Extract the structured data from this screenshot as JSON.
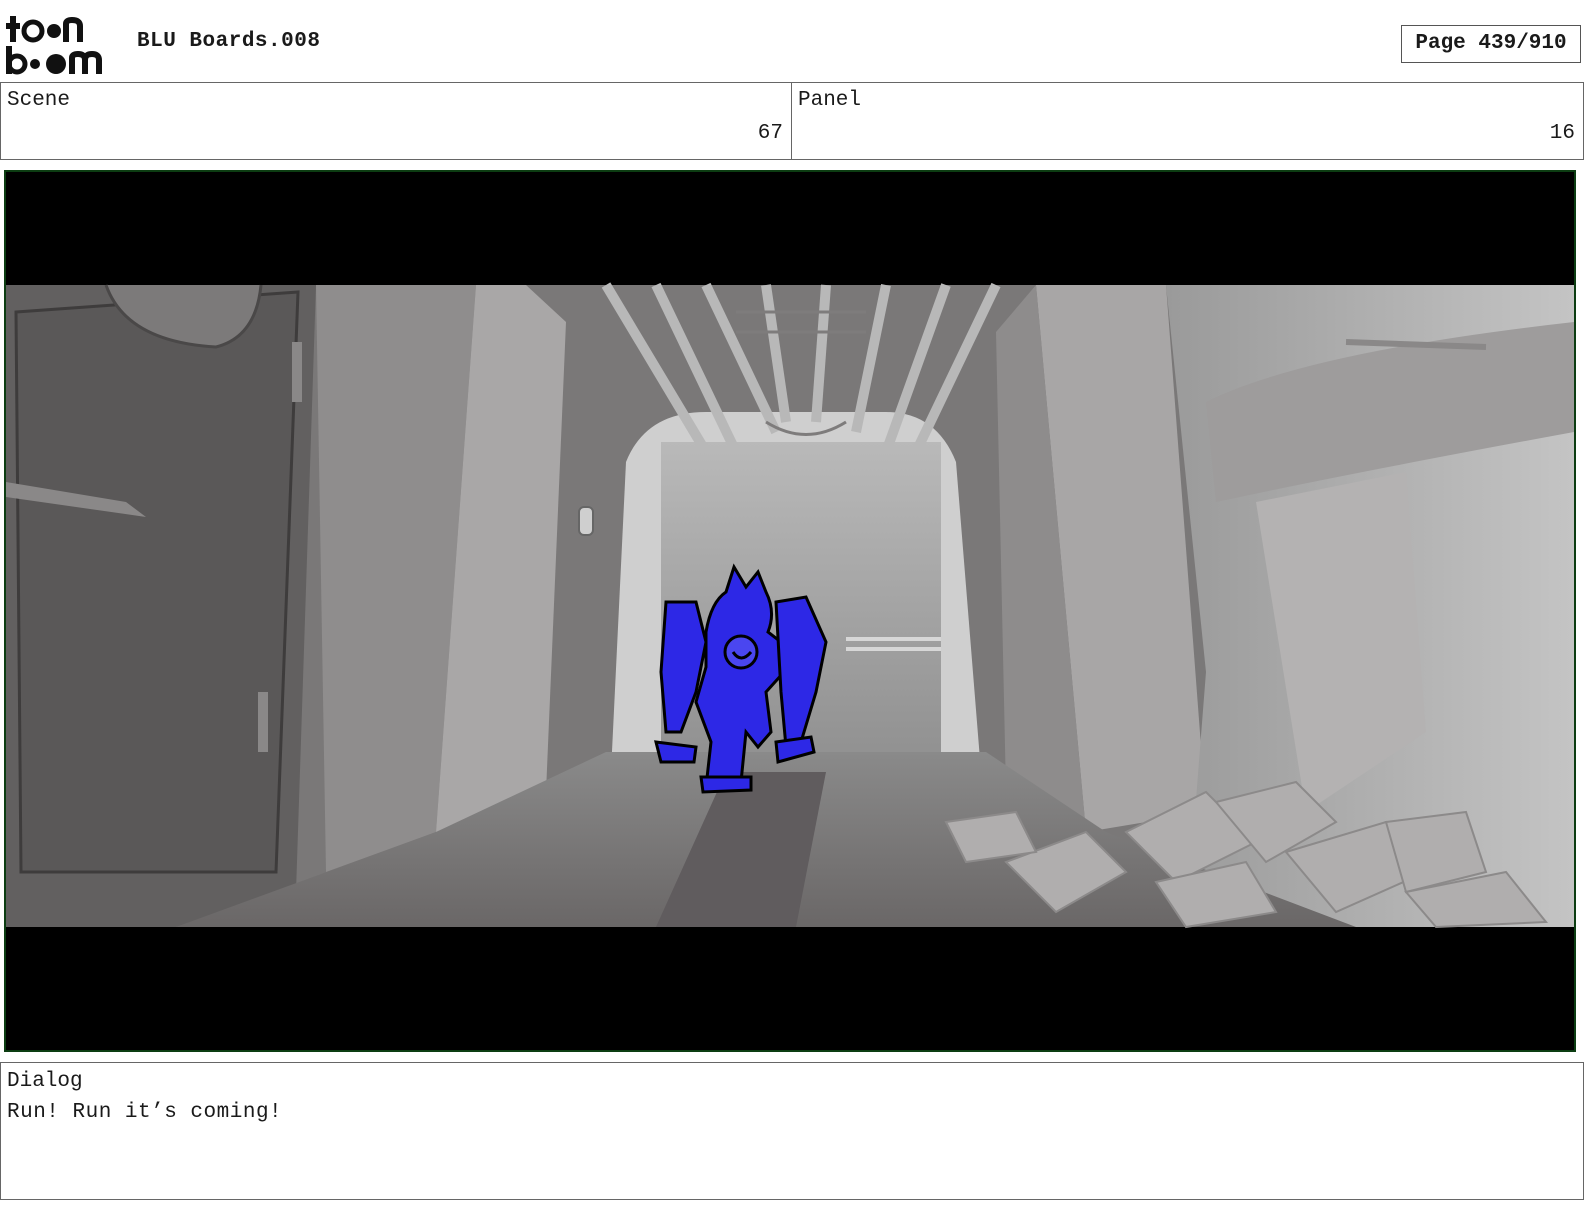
{
  "header": {
    "logo_text": "toonboom",
    "doc_title": "BLU Boards.008",
    "page_label": "Page 439/910"
  },
  "scene": {
    "label": "Scene",
    "value": "67"
  },
  "panel": {
    "label": "Panel",
    "value": "16"
  },
  "dialog": {
    "label": "Dialog",
    "text": "Run! Run it’s coming!"
  },
  "colors": {
    "character_fill": "#2d28e6",
    "frame_border": "#0c3d12",
    "letterbox": "#000000"
  }
}
